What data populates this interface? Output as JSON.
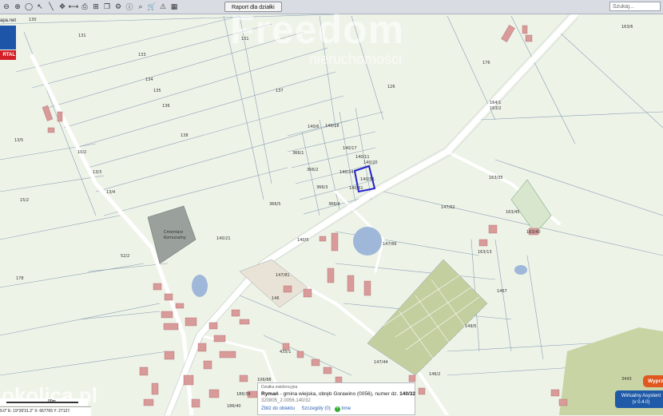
{
  "toolbar": {
    "icons": [
      "zoom-out-icon",
      "zoom-in-icon",
      "full-extent-icon",
      "pointer-icon",
      "measure-icon",
      "pan-icon",
      "measure-area-icon",
      "print-icon",
      "grid-icon",
      "layers-icon",
      "tools-icon",
      "info-icon",
      "search-map-icon",
      "cart-icon",
      "warning-icon",
      "color-palette-icon"
    ],
    "report_label": "Raport dla działki",
    "search_placeholder": "Szukaj..."
  },
  "branding": {
    "site_text": "apa.net",
    "portal_text": "RTAL",
    "watermark_title": "Freedom",
    "watermark_sub": "nieruchomości",
    "watermark_bottom": "okolica.pl"
  },
  "status": {
    "coords_text": "9.0\" E: 19°30'31.2\" X: 667765  Y: 27127.",
    "scale_text": "00m"
  },
  "popup": {
    "title": "Działka ewidencyjna",
    "place": "Rymań",
    "gmina": " - gmina wiejska",
    "obreb": ", obręb Gorawino (0056)",
    "numer": ", numer dz.",
    "parcel": "140/32",
    "id": "320805_2.0056.140/32",
    "link_zoom": "Zbliż do obiektu",
    "link_details": "Szczegóły (0)",
    "link_other": "Inne"
  },
  "buttons": {
    "red_label": "Wyprz",
    "blue_line1": "Wirtualny Asystent",
    "blue_line2": "(v 0.4.0)"
  },
  "map": {
    "colors": {
      "background": "#eef3e8",
      "road": "#ffffff",
      "parcel_line": "#8aa0b4",
      "building": "#d99a9a",
      "water": "#9fb7d9",
      "highlight": "#2222cc",
      "grass": "#c3cf9f"
    },
    "labels": [
      {
        "text": "130",
        "pos": "large-nw"
      },
      {
        "text": "131"
      },
      {
        "text": "133"
      },
      {
        "text": "134"
      },
      {
        "text": "135"
      },
      {
        "text": "136"
      },
      {
        "text": "137"
      },
      {
        "text": "138"
      },
      {
        "text": "131"
      },
      {
        "text": "126"
      },
      {
        "text": "176"
      },
      {
        "text": "163/6"
      },
      {
        "text": "164/1"
      },
      {
        "text": "163/2"
      },
      {
        "text": "13/5"
      },
      {
        "text": "10/2"
      },
      {
        "text": "13/3"
      },
      {
        "text": "13/4"
      },
      {
        "text": "15/2"
      },
      {
        "text": "52/2"
      },
      {
        "text": "178"
      },
      {
        "text": "140/6"
      },
      {
        "text": "140/18"
      },
      {
        "text": "140/17"
      },
      {
        "text": "140/11"
      },
      {
        "text": "140/20"
      },
      {
        "text": "140/24"
      },
      {
        "text": "140/32"
      },
      {
        "text": "140/31"
      },
      {
        "text": "366/1"
      },
      {
        "text": "366/2"
      },
      {
        "text": "366/3"
      },
      {
        "text": "366/4"
      },
      {
        "text": "366/5"
      },
      {
        "text": "147/62"
      },
      {
        "text": "163/35"
      },
      {
        "text": "163/45"
      },
      {
        "text": "163/40"
      },
      {
        "text": "163/13"
      },
      {
        "text": "147/66"
      },
      {
        "text": "140/5"
      },
      {
        "text": "140/21"
      },
      {
        "text": "147/81"
      },
      {
        "text": "146"
      },
      {
        "text": "1467"
      },
      {
        "text": "149/5"
      },
      {
        "text": "147/44"
      },
      {
        "text": "146/2"
      },
      {
        "text": "3443"
      },
      {
        "text": "186/39"
      },
      {
        "text": "186/40"
      },
      {
        "text": "106/88"
      },
      {
        "text": "435/1"
      },
      {
        "text": "Cmentarz Komunalny"
      }
    ]
  }
}
